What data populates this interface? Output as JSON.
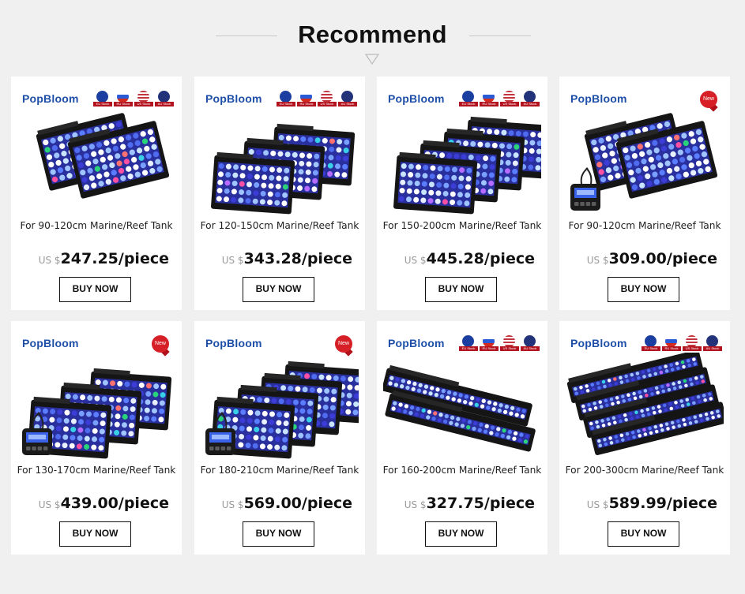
{
  "header": {
    "title": "Recommend"
  },
  "buy_label": "BUY NOW",
  "currency_prefix": "US $",
  "brand": "PopBloom",
  "flag_ribbons": [
    "EU Stock",
    "RU Stock",
    "US Stock",
    "AU Stock"
  ],
  "new_badge": "New",
  "colors": {
    "brand_blue": "#1e4fa8",
    "badge_red": "#d61f26",
    "background": "#f0f0f0"
  },
  "products": [
    {
      "description": "For 90-120cm Marine/Reef Tank",
      "price": "247.25/piece",
      "badge": "flags",
      "style": "wide",
      "units": 2,
      "controller": false
    },
    {
      "description": "For 120-150cm Marine/Reef Tank",
      "price": "343.28/piece",
      "badge": "flags",
      "style": "short",
      "units": 3,
      "controller": false
    },
    {
      "description": "For 150-200cm Marine/Reef Tank",
      "price": "445.28/piece",
      "badge": "flags",
      "style": "short",
      "units": 4,
      "controller": false
    },
    {
      "description": "For 90-120cm Marine/Reef Tank",
      "price": "309.00/piece",
      "badge": "new",
      "style": "wide",
      "units": 2,
      "controller": true
    },
    {
      "description": "For 130-170cm Marine/Reef Tank",
      "price": "439.00/piece",
      "badge": "new",
      "style": "short",
      "units": 3,
      "controller": true
    },
    {
      "description": "For 180-210cm Marine/Reef Tank",
      "price": "569.00/piece",
      "badge": "new",
      "style": "short",
      "units": 4,
      "controller": true
    },
    {
      "description": "For 160-200cm Marine/Reef Tank",
      "price": "327.75/piece",
      "badge": "flags",
      "style": "long",
      "units": 2,
      "controller": false
    },
    {
      "description": "For 200-300cm Marine/Reef Tank",
      "price": "589.99/piece",
      "badge": "flags",
      "style": "long",
      "units": 4,
      "controller": false
    }
  ]
}
